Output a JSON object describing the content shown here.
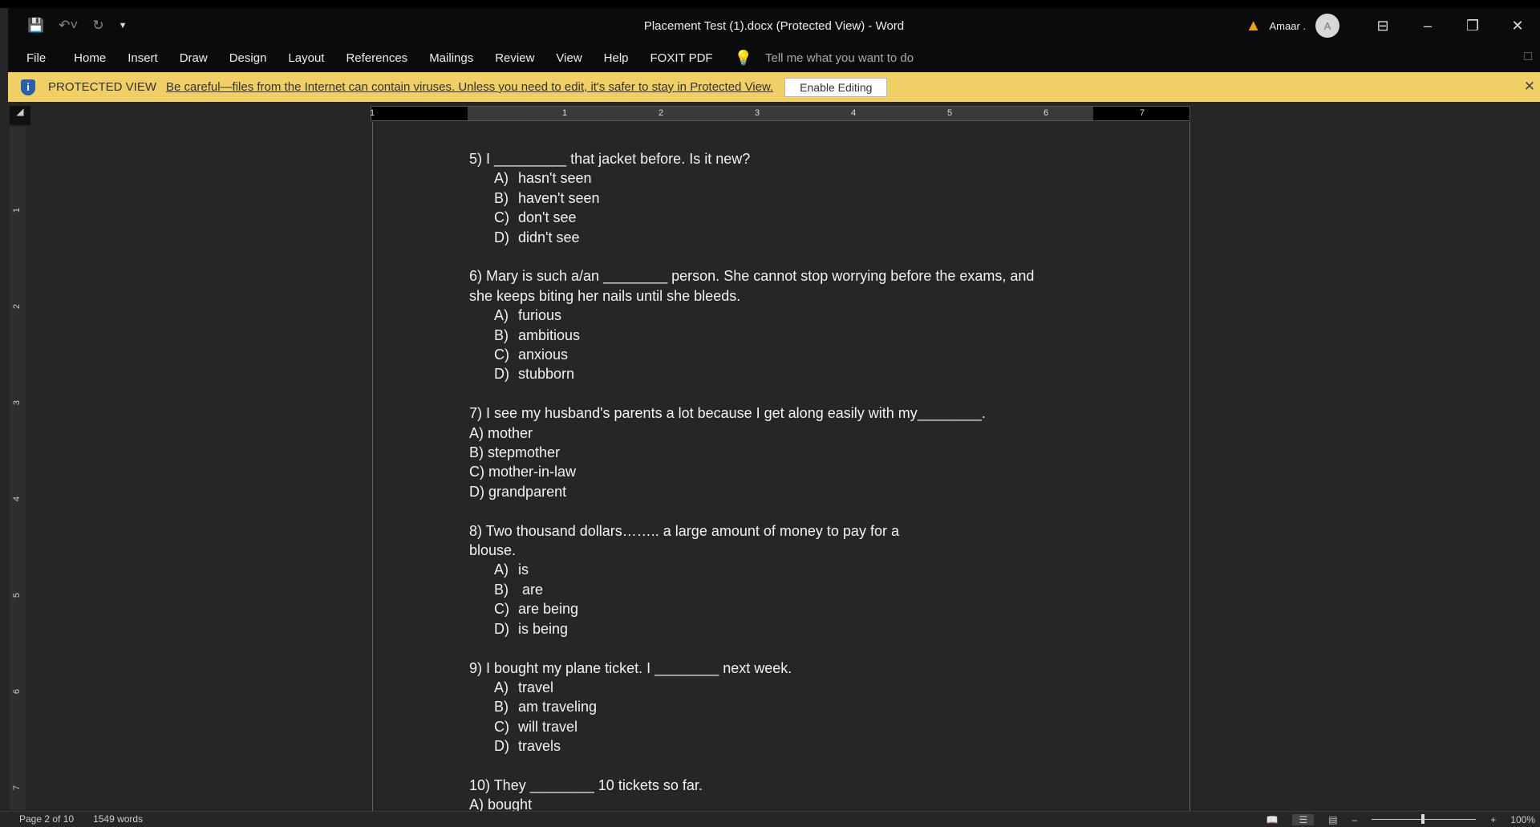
{
  "window": {
    "title": "Placement Test  (1).docx (Protected View)  -  Word",
    "user": "Amaar .",
    "avatar_initial": "A"
  },
  "qat": {
    "save_icon": "save-icon",
    "undo_icon": "undo-icon",
    "redo_icon": "redo-icon",
    "customize_icon": "customize-icon"
  },
  "ribbon": {
    "tabs": [
      "File",
      "Home",
      "Insert",
      "Draw",
      "Design",
      "Layout",
      "References",
      "Mailings",
      "Review",
      "View",
      "Help",
      "FOXIT PDF"
    ],
    "tell_me": "Tell me what you want to do"
  },
  "protected_view": {
    "label": "PROTECTED VIEW",
    "message": "Be careful—files from the Internet can contain viruses. Unless you need to edit, it's safer to stay in Protected View.",
    "button": "Enable Editing",
    "color": "#f0cf66"
  },
  "ruler": {
    "numbers": [
      "1",
      "1",
      "2",
      "3",
      "4",
      "5",
      "6",
      "7"
    ],
    "vertical": [
      "1",
      "2",
      "3",
      "4",
      "5",
      "6",
      "7"
    ]
  },
  "document": {
    "blocks": [
      {
        "q": [
          "5) I _________ that jacket before. Is it new?"
        ],
        "indent": true,
        "opts": [
          [
            "A)",
            "hasn't seen"
          ],
          [
            "B)",
            "haven't seen"
          ],
          [
            "C)",
            "don't see"
          ],
          [
            "D)",
            "didn't see"
          ]
        ]
      },
      {
        "q": [
          "6) Mary is such a/an ________ person. She cannot stop worrying before the exams, and",
          "she keeps biting her nails until she bleeds."
        ],
        "indent": true,
        "opts": [
          [
            "A)",
            "furious"
          ],
          [
            "B)",
            "ambitious"
          ],
          [
            "C)",
            "anxious"
          ],
          [
            "D)",
            "stubborn"
          ]
        ]
      },
      {
        "q": [
          "7)  I see my husband's parents a lot because I get along easily with my________."
        ],
        "indent": false,
        "opts": [
          [
            "A)",
            "mother"
          ],
          [
            "B)",
            "stepmother"
          ],
          [
            "C)",
            "mother-in-law"
          ],
          [
            "D)",
            "grandparent"
          ]
        ]
      },
      {
        "q": [
          "8) Two thousand dollars…….. a large amount of money to pay for a",
          "blouse."
        ],
        "indent": true,
        "opts": [
          [
            "A)",
            "is"
          ],
          [
            "B)",
            " are"
          ],
          [
            "C)",
            "are being"
          ],
          [
            "D)",
            "is being"
          ]
        ]
      },
      {
        "q": [
          "9) I bought my plane ticket. I ________ next week."
        ],
        "indent": true,
        "opts": [
          [
            "A)",
            "travel"
          ],
          [
            "B)",
            "am traveling"
          ],
          [
            "C)",
            "will travel"
          ],
          [
            "D)",
            "travels"
          ]
        ]
      },
      {
        "q": [
          "10) They ________ 10 tickets so far."
        ],
        "indent": false,
        "opts": [
          [
            "A)",
            "bought"
          ]
        ]
      }
    ]
  },
  "status": {
    "page": "Page 2 of 10",
    "words": "1549 words",
    "zoom": "100%",
    "zoom_level_percent": 100
  }
}
